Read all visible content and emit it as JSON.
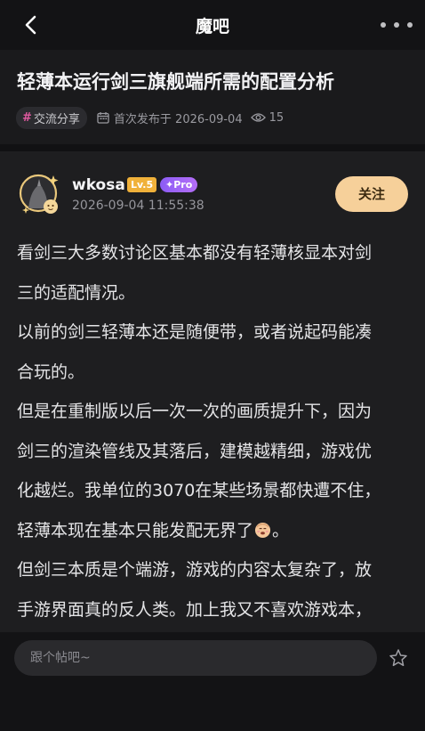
{
  "topbar": {
    "title": "魔吧"
  },
  "post": {
    "title": "轻薄本运行剑三旗舰端所需的配置分析",
    "tag": "交流分享",
    "published": "首次发布于 2026-09-04",
    "views": "15"
  },
  "author": {
    "name": "wkosa",
    "level": "Lv.5",
    "pro": "Pro",
    "time": "2026-09-04 11:55:38",
    "follow_label": "关注"
  },
  "body": {
    "lines": [
      "看剑三大多数讨论区基本都没有轻薄核显本对剑",
      "三的适配情况。",
      "以前的剑三轻薄本还是随便带，或者说起码能凑",
      "合玩的。",
      "但是在重制版以后一次一次的画质提升下，因为",
      "剑三的渲染管线及其落后，建模越精细，游戏优",
      "化越烂。我单位的3070在某些场景都快遭不住，",
      "轻薄本现在基本只能发配无界了",
      "但剑三本质是个端游，游戏的内容太复杂了，放",
      "手游界面真的反人类。加上我又不喜欢游戏本，"
    ],
    "line8_suffix": "。"
  },
  "reply": {
    "placeholder": "跟个帖吧~"
  },
  "colors": {
    "follow": "#f6d09a",
    "level": "#f0b13a",
    "pro": "#9d64f6",
    "tag_hash": "#e05aa0"
  },
  "icons": [
    "back-arrow-icon",
    "more-dots-icon",
    "calendar-icon",
    "eye-icon",
    "star-icon",
    "sweat-face-emoji"
  ]
}
